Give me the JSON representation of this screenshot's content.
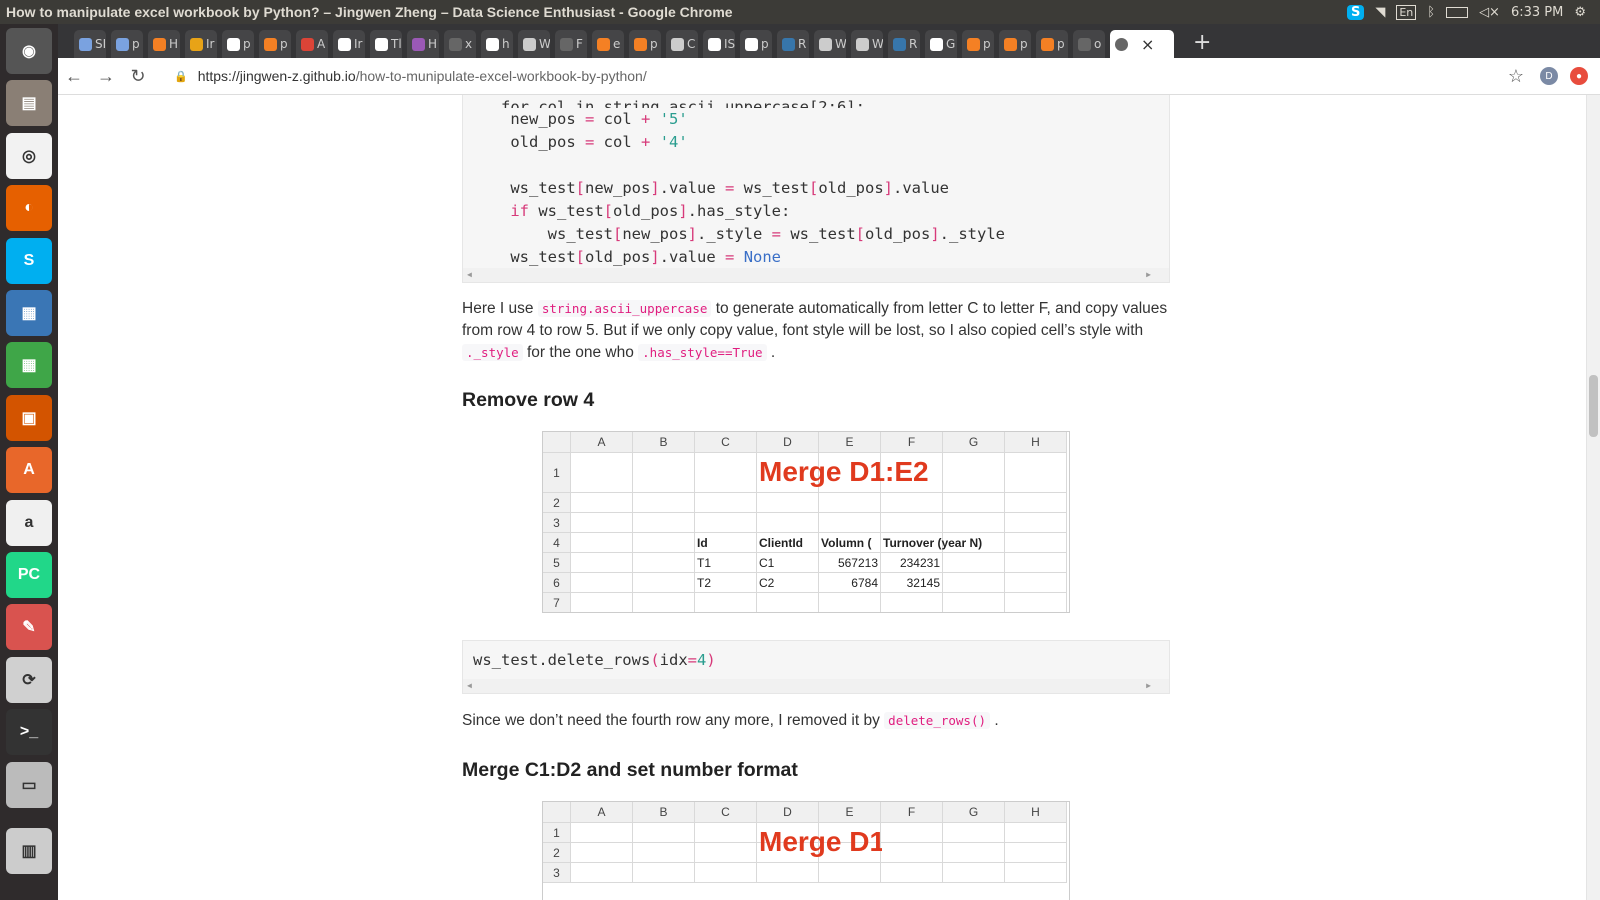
{
  "window": {
    "title": "How to manipulate excel workbook by Python? – Jingwen Zheng – Data Science Enthusiast - Google Chrome"
  },
  "tray": {
    "keyboard": "En",
    "time": "6:33 PM"
  },
  "launcher": {
    "items": [
      "dash-home",
      "files",
      "chrome",
      "firefox",
      "skype",
      "writer",
      "calc",
      "impress",
      "software-center",
      "amazon",
      "pycharm",
      "settings",
      "updater",
      "terminal",
      "drive",
      "trash"
    ]
  },
  "tabs": [
    {
      "label": "SI",
      "color": "#7aa2e0"
    },
    {
      "label": "p",
      "color": "#7aa2e0"
    },
    {
      "label": "H",
      "color": "#f48024"
    },
    {
      "label": "Ir",
      "color": "#e8a317"
    },
    {
      "label": "p",
      "color": "#ffffff"
    },
    {
      "label": "p",
      "color": "#f48024"
    },
    {
      "label": "A",
      "color": "#db4437"
    },
    {
      "label": "Ir",
      "color": "#ffffff"
    },
    {
      "label": "Tl",
      "color": "#ffffff"
    },
    {
      "label": "H",
      "color": "#9b59b6"
    },
    {
      "label": "x",
      "color": "#666666"
    },
    {
      "label": "h",
      "color": "#ffffff"
    },
    {
      "label": "W",
      "color": "#cccccc"
    },
    {
      "label": "F",
      "color": "#666666"
    },
    {
      "label": "e",
      "color": "#f48024"
    },
    {
      "label": "p",
      "color": "#f48024"
    },
    {
      "label": "C",
      "color": "#cccccc"
    },
    {
      "label": "IS",
      "color": "#ffffff"
    },
    {
      "label": "p",
      "color": "#ffffff"
    },
    {
      "label": "R",
      "color": "#3776ab"
    },
    {
      "label": "W",
      "color": "#cccccc"
    },
    {
      "label": "W",
      "color": "#cccccc"
    },
    {
      "label": "R",
      "color": "#3776ab"
    },
    {
      "label": "G",
      "color": "#ffffff"
    },
    {
      "label": "p",
      "color": "#f48024"
    },
    {
      "label": "p",
      "color": "#f48024"
    },
    {
      "label": "p",
      "color": "#f48024"
    },
    {
      "label": "o",
      "color": "#666666"
    }
  ],
  "active_tab": {
    "close": "×"
  },
  "newtab": "+",
  "toolbar": {
    "back": "←",
    "forward": "→",
    "reload": "↻",
    "star": "☆",
    "profile": "D"
  },
  "url": {
    "host": "https://jingwen-z.github.io",
    "path": "/how-to-munipulate-excel-workbook-by-python/"
  },
  "article": {
    "code1_lines": [
      [
        "    ",
        "new_pos",
        " = col + ",
        "'5'"
      ],
      [
        "    ",
        "old_pos",
        " = col + ",
        "'4'"
      ]
    ],
    "para1": {
      "t1": "Here I use ",
      "c1": "string.ascii_uppercase",
      "t2": " to generate automatically from letter C to letter F, and copy values from row 4 to row 5. But if we only copy value, font style will be lost, so I also copied cell’s style with ",
      "c2": "._style",
      "t3": " for the one who ",
      "c3": ".has_style==True",
      "t4": " ."
    },
    "heading1": "Remove row 4",
    "sheet1": {
      "cols": [
        "A",
        "B",
        "C",
        "D",
        "E",
        "F",
        "G",
        "H"
      ],
      "rows": [
        "1",
        "2",
        "3",
        "4",
        "5",
        "6",
        "7"
      ],
      "merge_text": "Merge D1:E2",
      "r4": [
        "Id",
        "ClientId",
        "Volumn (",
        "Turnover (year N)"
      ],
      "r5": [
        "T1",
        "C1",
        "567213",
        "234231"
      ],
      "r6": [
        "T2",
        "C2",
        "6784",
        "32145"
      ]
    },
    "code2": "ws_test.delete_rows(idx=4)",
    "para2": {
      "t1": "Since we don’t need the fourth row any more, I removed it by ",
      "c1": "delete_rows()",
      "t2": " ."
    },
    "heading2": "Merge C1:D2 and set number format",
    "sheet2": {
      "cols": [
        "A",
        "B",
        "C",
        "D",
        "E",
        "F",
        "G",
        "H"
      ],
      "rows": [
        "1",
        "2",
        "3"
      ],
      "merge_text": "Merge D1"
    }
  }
}
